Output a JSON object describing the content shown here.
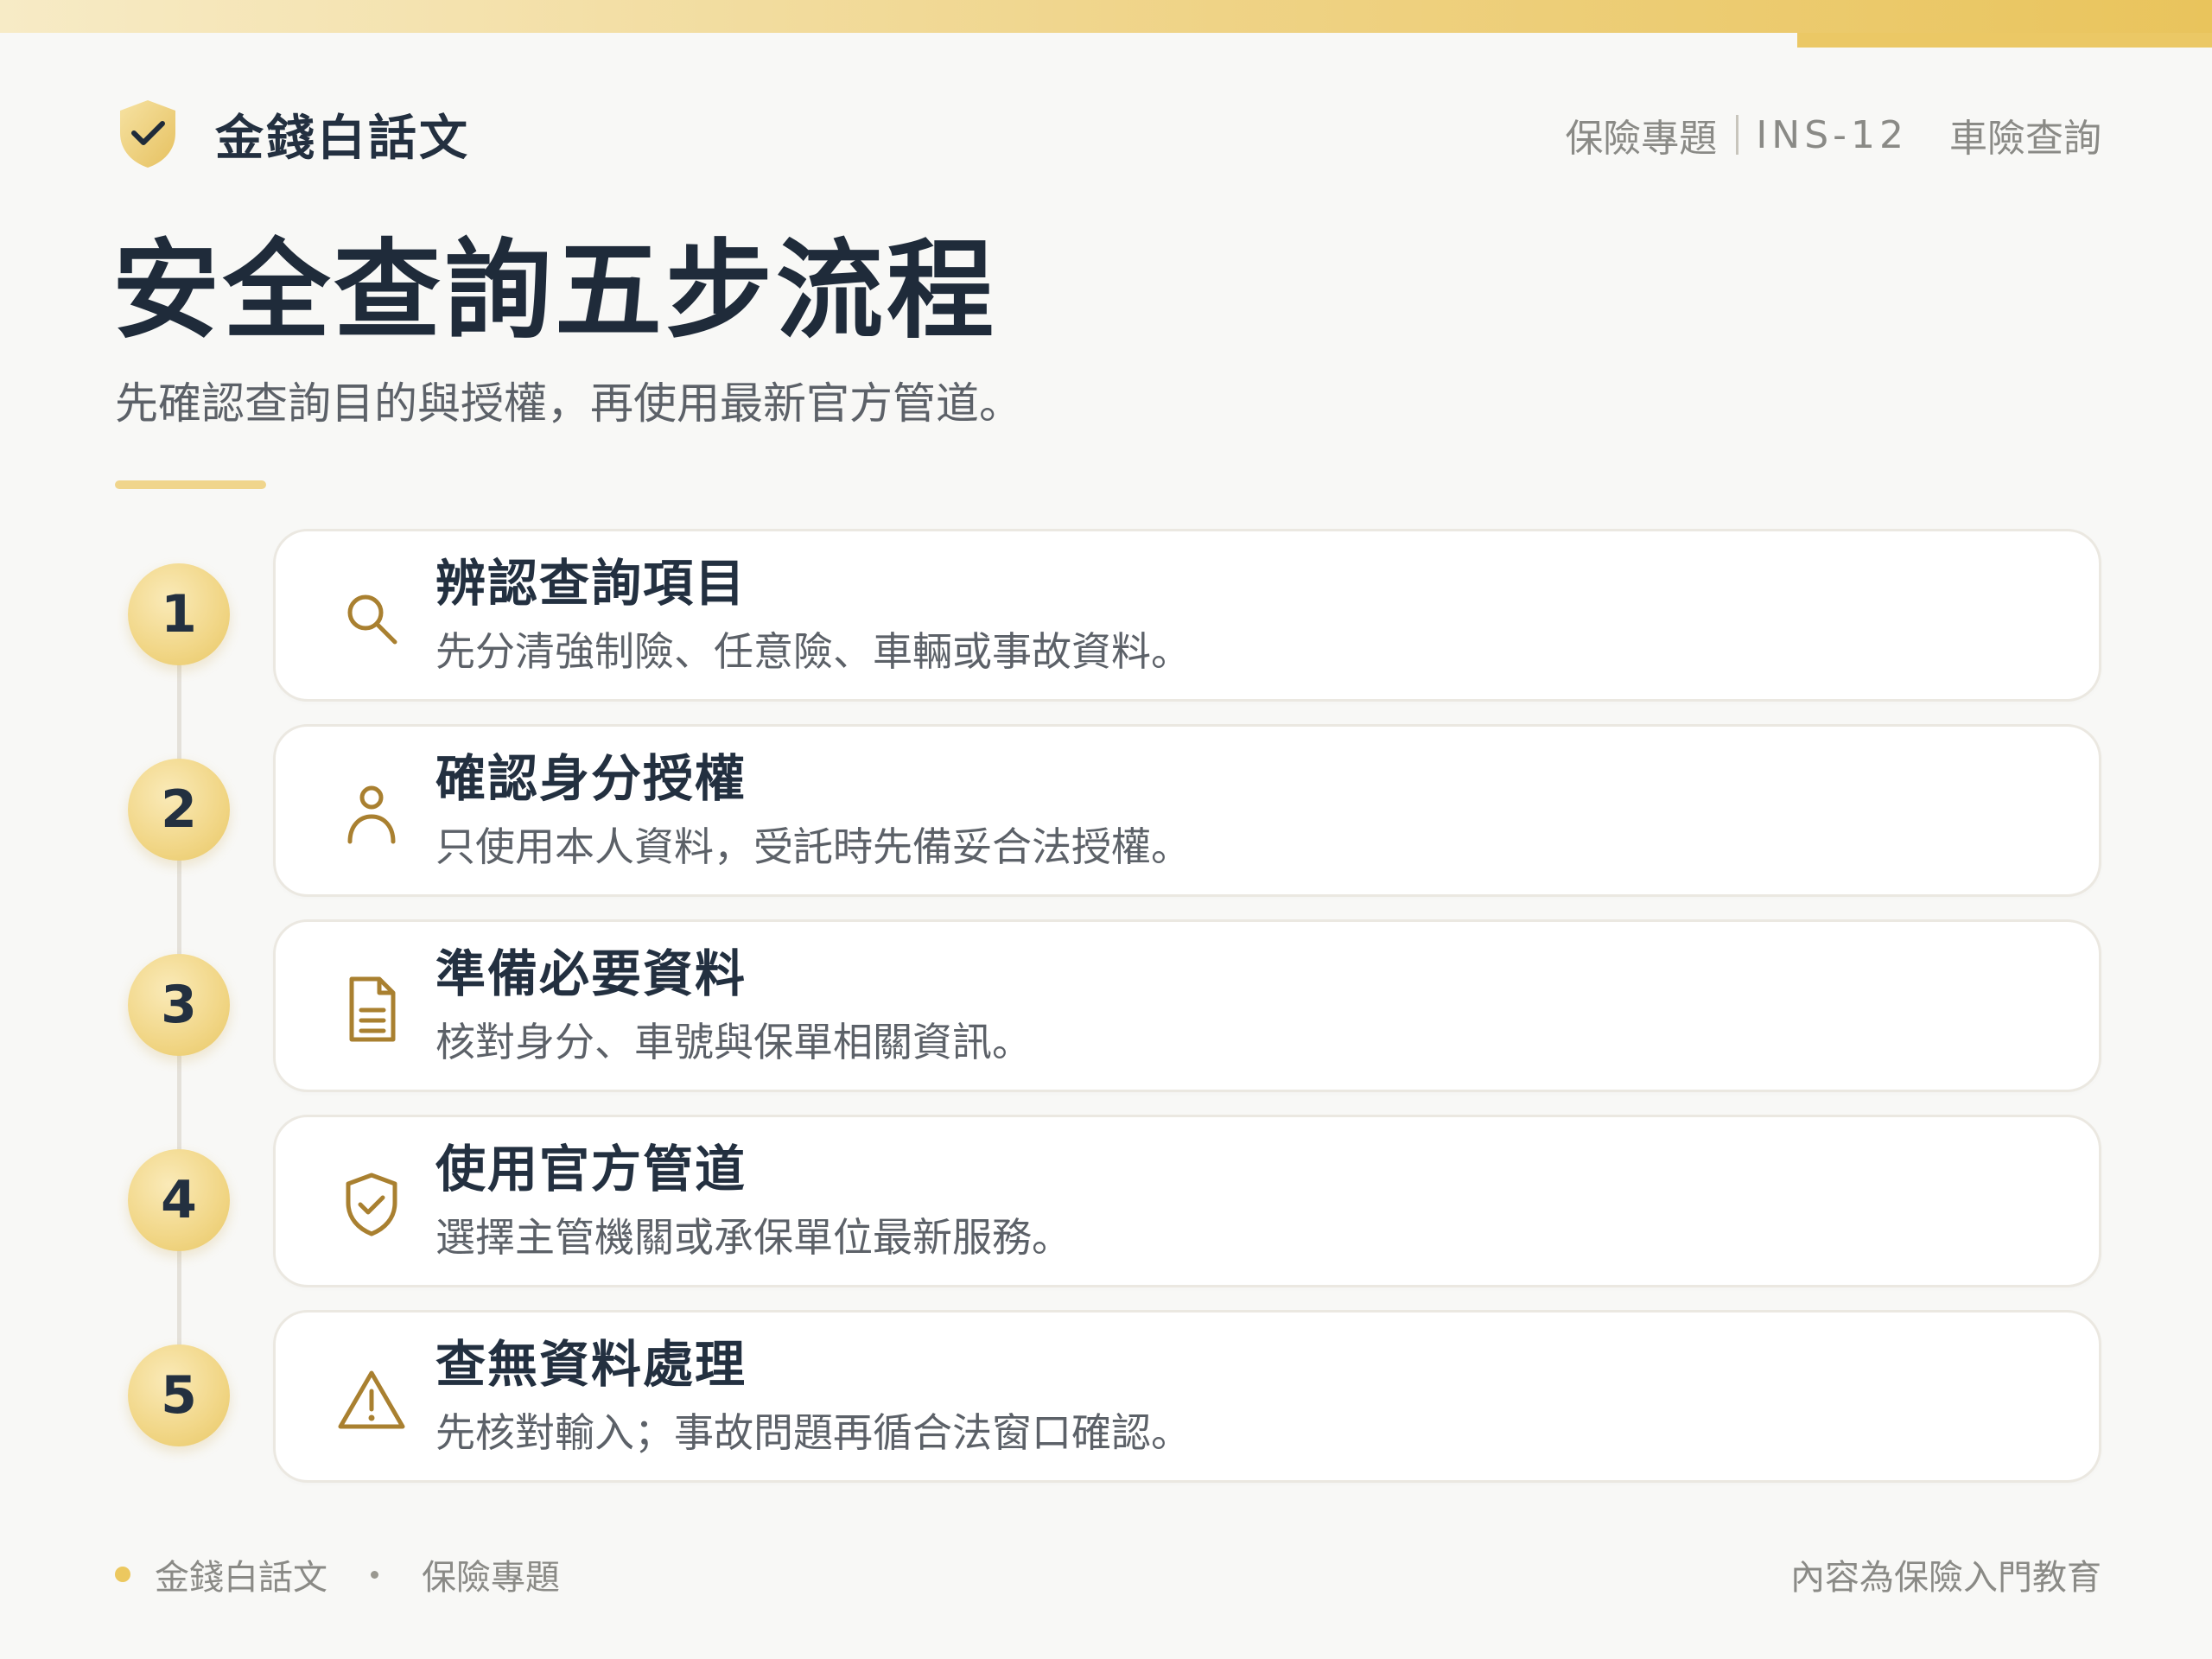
{
  "brand": {
    "name": "金錢白話文",
    "icon": "shield-check-icon"
  },
  "meta": {
    "category": "保險專題",
    "code": "INS-12",
    "topic": "車險查詢"
  },
  "title": "安全查詢五步流程",
  "subtitle": "先確認查詢目的與授權，再使用最新官方管道。",
  "steps": [
    {
      "number": "1",
      "icon": "search-icon",
      "title": "辨認查詢項目",
      "desc": "先分清強制險、任意險、車輛或事故資料。"
    },
    {
      "number": "2",
      "icon": "person-icon",
      "title": "確認身分授權",
      "desc": "只使用本人資料，受託時先備妥合法授權。"
    },
    {
      "number": "3",
      "icon": "document-icon",
      "title": "準備必要資料",
      "desc": "核對身分、車號與保單相關資訊。"
    },
    {
      "number": "4",
      "icon": "shield-check-icon",
      "title": "使用官方管道",
      "desc": "選擇主管機關或承保單位最新服務。"
    },
    {
      "number": "5",
      "icon": "warning-icon",
      "title": "查無資料處理",
      "desc": "先核對輸入；事故問題再循合法窗口確認。"
    }
  ],
  "footer": {
    "brand": "金錢白話文",
    "category": "保險專題",
    "note": "內容為保險入門教育"
  },
  "colors": {
    "gold": "#e9c45c",
    "icon_gold": "#a98030",
    "navy": "#233040",
    "background": "#f8f8f6"
  }
}
